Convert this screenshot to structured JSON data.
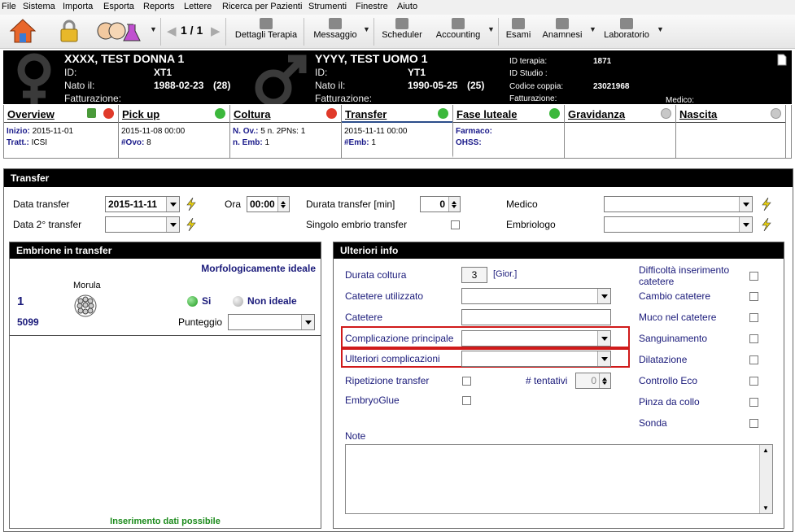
{
  "menu": [
    "File",
    "Sistema",
    "Importa",
    "Esporta",
    "Reports",
    "Lettere",
    "Ricerca per Pazienti",
    "Strumenti",
    "Finestre",
    "Aiuto"
  ],
  "toolbar": {
    "pager": "1 / 1",
    "dettagli": "Dettagli Terapia",
    "messaggio": "Messaggio",
    "scheduler": "Scheduler",
    "accounting": "Accounting",
    "esami": "Esami",
    "anamnesi": "Anamnesi",
    "laboratorio": "Laboratorio"
  },
  "female": {
    "name": "XXXX, TEST DONNA 1",
    "id_label": "ID:",
    "id": "XT1",
    "nato_label": "Nato il:",
    "nato": "1988-02-23",
    "age": "(28)",
    "fatt_label": "Fatturazione:"
  },
  "male": {
    "name": "YYYY, TEST UOMO 1",
    "id_label": "ID:",
    "id": "YT1",
    "nato_label": "Nato il:",
    "nato": "1990-05-25",
    "age": "(25)",
    "fatt_label": "Fatturazione:"
  },
  "therapy": {
    "id_terapia_label": "ID terapia:",
    "id_terapia": "1871",
    "id_studio_label": "ID Studio :",
    "codice_label": "Codice coppia:",
    "codice": "23021968",
    "fatt_label": "Fatturazione:",
    "medico_label": "Medico:"
  },
  "phases": [
    {
      "title": "Overview",
      "status": "error",
      "l1k": "Inizio:",
      "l1v": "2015-11-01",
      "l2k": "Tratt.:",
      "l2v": "ICSI"
    },
    {
      "title": "Pick up",
      "status": "ok",
      "l1k": "",
      "l1v": "2015-11-08 00:00",
      "l2k": "#Ovo:",
      "l2v": "8"
    },
    {
      "title": "Coltura",
      "status": "error",
      "l1k": "N. Ov.:",
      "l1v": "5 n. 2PNs: 1",
      "l2k": "n. Emb:",
      "l2v": "1"
    },
    {
      "title": "Transfer",
      "status": "ok",
      "l1k": "",
      "l1v": "2015-11-11 00:00",
      "l2k": "#Emb:",
      "l2v": "1"
    },
    {
      "title": "Fase luteale",
      "status": "ok",
      "l1k": "Farmaco:",
      "l1v": "",
      "l2k": "OHSS:",
      "l2v": ""
    },
    {
      "title": "Gravidanza",
      "status": "gray",
      "l1k": "",
      "l1v": "",
      "l2k": "",
      "l2v": ""
    },
    {
      "title": "Nascita",
      "status": "gray",
      "l1k": "",
      "l1v": "",
      "l2k": "",
      "l2v": ""
    }
  ],
  "transfer": {
    "title": "Transfer",
    "data_transfer_label": "Data transfer",
    "data_transfer": "2015-11-11",
    "ora_label": "Ora",
    "ora": "00:00",
    "durata_label": "Durata transfer [min]",
    "durata": "0",
    "medico_label": "Medico",
    "data2_label": "Data 2° transfer",
    "singolo_label": "Singolo embrio transfer",
    "embriologo_label": "Embriologo"
  },
  "embrione": {
    "title": "Embrione in transfer",
    "morfo": "Morfologicamente ideale",
    "num": "1",
    "code": "5099",
    "stage": "Morula",
    "si": "Si",
    "non_ideale": "Non ideale",
    "punteggio": "Punteggio",
    "footer": "Inserimento dati possibile"
  },
  "ulteriori": {
    "title": "Ulteriori info",
    "durata_coltura_label": "Durata coltura",
    "durata_coltura": "3",
    "giorni": "[Gior.]",
    "catetere_util": "Catetere utilizzato",
    "catetere": "Catetere",
    "compl_princ": "Complicazione principale",
    "ult_compl": "Ulteriori complicazioni",
    "ripetizione": "Ripetizione transfer",
    "tentativi": "# tentativi",
    "tentativi_val": "0",
    "embryoglue": "EmbryoGlue",
    "note": "Note",
    "right": [
      "Difficoltà inserimento catetere",
      "Cambio catetere",
      "Muco nel catetere",
      "Sanguinamento",
      "Dilatazione",
      "Controllo Eco",
      "Pinza da collo",
      "Sonda"
    ]
  }
}
